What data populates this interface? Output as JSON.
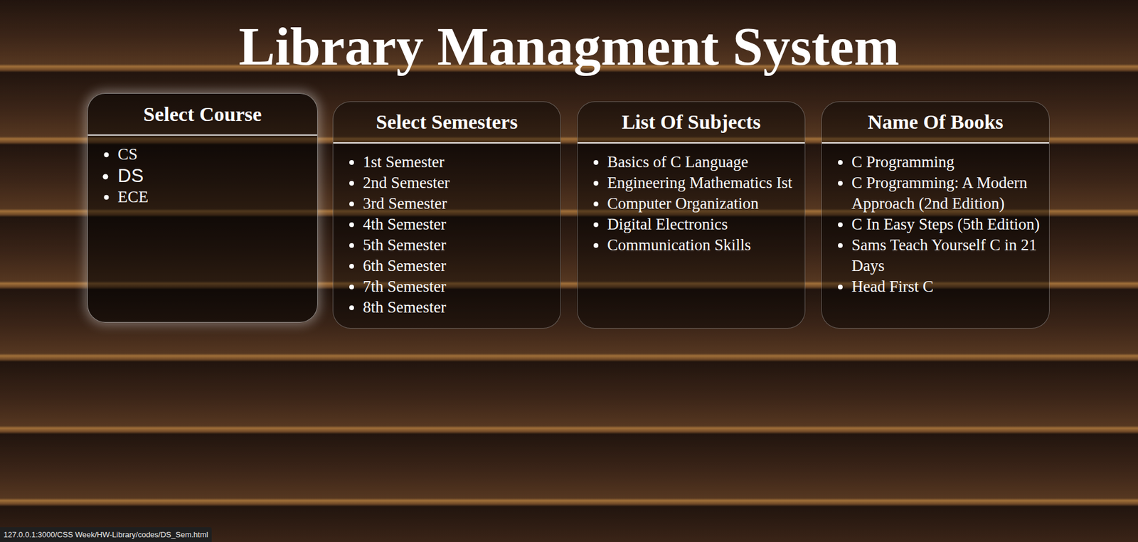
{
  "page": {
    "title": "Library Managment System"
  },
  "panels": [
    {
      "heading": "Select Course",
      "hovered": true,
      "scrollable": false,
      "items": [
        {
          "label": "CS",
          "hovered": false
        },
        {
          "label": "DS",
          "hovered": true
        },
        {
          "label": "ECE",
          "hovered": false
        }
      ]
    },
    {
      "heading": "Select Semesters",
      "hovered": false,
      "scrollable": false,
      "items": [
        {
          "label": "1st Semester",
          "hovered": false
        },
        {
          "label": "2nd Semester",
          "hovered": false
        },
        {
          "label": "3rd Semester",
          "hovered": false
        },
        {
          "label": "4th Semester",
          "hovered": false
        },
        {
          "label": "5th Semester",
          "hovered": false
        },
        {
          "label": "6th Semester",
          "hovered": false
        },
        {
          "label": "7th Semester",
          "hovered": false
        },
        {
          "label": "8th Semester",
          "hovered": false
        }
      ]
    },
    {
      "heading": "List Of Subjects",
      "hovered": false,
      "scrollable": false,
      "items": [
        {
          "label": "Basics of C Language",
          "hovered": false
        },
        {
          "label": "Engineering Mathematics Ist",
          "hovered": false
        },
        {
          "label": "Computer Organization",
          "hovered": false
        },
        {
          "label": "Digital Electronics",
          "hovered": false
        },
        {
          "label": "Communication Skills",
          "hovered": false
        }
      ]
    },
    {
      "heading": "Name Of Books",
      "hovered": false,
      "scrollable": true,
      "items": [
        {
          "label": "C Programming",
          "hovered": false
        },
        {
          "label": "C Programming: A Modern Approach (2nd Edition)",
          "hovered": false
        },
        {
          "label": "C In Easy Steps (5th Edition)",
          "hovered": false
        },
        {
          "label": "Sams Teach Yourself C in 21 Days",
          "hovered": false
        },
        {
          "label": "Head First C",
          "hovered": false
        }
      ]
    }
  ],
  "status_bar": {
    "url": "127.0.0.1:3000/CSS Week/HW-Library/codes/DS_Sem.html"
  }
}
